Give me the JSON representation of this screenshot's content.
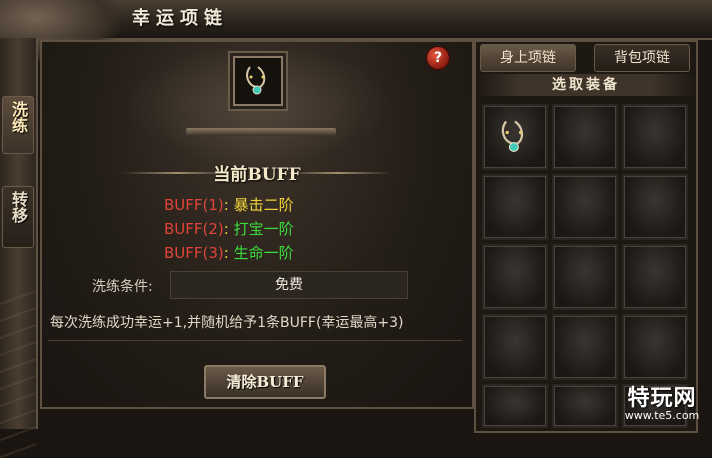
{
  "window": {
    "title": "幸运项链"
  },
  "side_tabs": [
    {
      "label": "洗练"
    },
    {
      "label": "转移"
    }
  ],
  "help": {
    "label": "?"
  },
  "buff_section": {
    "title": "当前BUFF",
    "buffs": [
      {
        "key": "BUFF(1)",
        "sep": ":",
        "value": "暴击二阶",
        "value_color": "#f0d33a"
      },
      {
        "key": "BUFF(2)",
        "sep": ":",
        "value": "打宝一阶",
        "value_color": "#3cdc3c"
      },
      {
        "key": "BUFF(3)",
        "sep": ":",
        "value": "生命一阶",
        "value_color": "#3cdc3c"
      }
    ]
  },
  "condition": {
    "label": "洗练条件:",
    "value": "免费"
  },
  "info": "每次洗练成功幸运+1,并随机给予1条BUFF(幸运最高+3)",
  "clear_button": "清除BUFF",
  "right_tabs": [
    {
      "label": "身上项链"
    },
    {
      "label": "背包项链"
    }
  ],
  "select_title": "选取装备",
  "equipment_slots": [
    {
      "item": "necklace-icon"
    },
    {
      "item": null
    },
    {
      "item": null
    },
    {
      "item": null
    },
    {
      "item": null
    },
    {
      "item": null
    },
    {
      "item": null
    },
    {
      "item": null
    },
    {
      "item": null
    },
    {
      "item": null
    },
    {
      "item": null
    },
    {
      "item": null
    },
    {
      "item": null
    },
    {
      "item": null
    },
    {
      "item": null
    }
  ],
  "watermark": {
    "main": "特玩网",
    "sub": "www.te5.com"
  },
  "colors": {
    "buff_key": "#e04438",
    "yellow": "#f0d33a",
    "green": "#3cdc3c",
    "gold_border": "#8a7a66"
  }
}
